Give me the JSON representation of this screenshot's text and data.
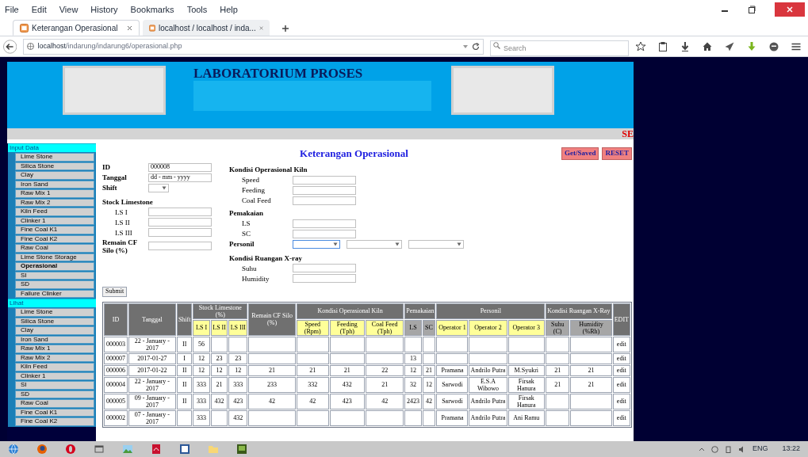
{
  "menu": [
    "File",
    "Edit",
    "View",
    "History",
    "Bookmarks",
    "Tools",
    "Help"
  ],
  "tabs": [
    {
      "title": "Keterangan Operasional",
      "selected": true
    },
    {
      "title": "localhost / localhost / inda...",
      "selected": false
    }
  ],
  "url": {
    "host": "localhost",
    "path": "/indarung/indarung6/operasional.php"
  },
  "search": {
    "placeholder": "Search"
  },
  "page": {
    "header_title": "LABORATORIUM PROSES",
    "marquee": "SE",
    "sidebar": [
      {
        "title": "Input Data",
        "items": [
          {
            "label": "Lime Stone",
            "selected": false
          },
          {
            "label": "Silica Stone",
            "selected": false
          },
          {
            "label": "Clay",
            "selected": false
          },
          {
            "label": "Iron Sand",
            "selected": false
          },
          {
            "label": "Raw Mix 1",
            "selected": false
          },
          {
            "label": "Raw Mix 2",
            "selected": false
          },
          {
            "label": "Kiln Feed",
            "selected": false
          },
          {
            "label": "Clinker 1",
            "selected": false
          },
          {
            "label": "Fine Coal K1",
            "selected": false
          },
          {
            "label": "Fine Coal K2",
            "selected": false
          },
          {
            "label": "Raw Coal",
            "selected": false
          },
          {
            "label": "Lime Stone Storage",
            "selected": false
          },
          {
            "label": "Operasional",
            "selected": true
          },
          {
            "label": "SI",
            "selected": false
          },
          {
            "label": "SD",
            "selected": false
          },
          {
            "label": "Failure Clinker",
            "selected": false
          }
        ]
      },
      {
        "title": "Lihat",
        "items": [
          {
            "label": "Lime Stone",
            "selected": false
          },
          {
            "label": "Silica Stone",
            "selected": false
          },
          {
            "label": "Clay",
            "selected": false
          },
          {
            "label": "Iron Sand",
            "selected": false
          },
          {
            "label": "Raw Mix 1",
            "selected": false
          },
          {
            "label": "Raw Mix 2",
            "selected": false
          },
          {
            "label": "Kiln Feed",
            "selected": false
          },
          {
            "label": "Clinker 1",
            "selected": false
          },
          {
            "label": "SI",
            "selected": false
          },
          {
            "label": "SD",
            "selected": false
          },
          {
            "label": "Raw Coal",
            "selected": false
          },
          {
            "label": "Fine Coal K1",
            "selected": false
          },
          {
            "label": "Fine Coal K2",
            "selected": false
          }
        ]
      }
    ],
    "title": "Keterangan Operasional",
    "top_buttons": [
      "Get/Saved",
      "RESET"
    ],
    "form_left": [
      {
        "kind": "field",
        "label": "ID",
        "value": "000008"
      },
      {
        "kind": "field",
        "label": "Tanggal",
        "value": "dd - mm - yyyy"
      },
      {
        "kind": "select",
        "label": "Shift"
      },
      {
        "kind": "heading",
        "label": "Stock Limestone"
      },
      {
        "kind": "subfield",
        "label": "LS I"
      },
      {
        "kind": "subfield",
        "label": "LS II"
      },
      {
        "kind": "subfield",
        "label": "LS III"
      },
      {
        "kind": "field",
        "label": "Remain CF Silo (%)"
      }
    ],
    "form_right": [
      {
        "kind": "heading",
        "label": "Kondisi Operasional Kiln"
      },
      {
        "kind": "subfield",
        "label": "Speed"
      },
      {
        "kind": "subfield",
        "label": "Feeding"
      },
      {
        "kind": "subfield",
        "label": "Coal Feed"
      },
      {
        "kind": "heading",
        "label": "Pemakaian"
      },
      {
        "kind": "subfield",
        "label": "LS"
      },
      {
        "kind": "subfield",
        "label": "SC"
      },
      {
        "kind": "selects",
        "label": "Personil",
        "selects": [
          {
            "focused": true
          },
          {
            "focused": false
          },
          {
            "focused": false
          }
        ]
      },
      {
        "kind": "heading",
        "label": "Kondisi Ruangan X-ray"
      },
      {
        "kind": "subfield",
        "label": "Suhu"
      },
      {
        "kind": "subfield",
        "label": "Humidity"
      }
    ],
    "submit": "Submit",
    "table": {
      "header_groups": [
        {
          "label": "ID"
        },
        {
          "label": "Tanggal"
        },
        {
          "label": "Shift"
        },
        {
          "label": "Stock Limestone (%)",
          "subcolumns": [
            {
              "label": "LS I",
              "color": "#ffff99"
            },
            {
              "label": "LS II",
              "color": "#ffff99"
            },
            {
              "label": "LS III",
              "color": "#ffff99"
            }
          ]
        },
        {
          "label": "Remain CF Silo (%)"
        },
        {
          "label": "Kondisi Operasional Kiln",
          "subcolumns": [
            {
              "label": "Speed (Rpm)",
              "color": "#ffff99"
            },
            {
              "label": "Feeding (Tph)",
              "color": "#ffff99"
            },
            {
              "label": "Coal Feed (Tph)",
              "color": "#ffff99"
            }
          ]
        },
        {
          "label": "Pemakaian",
          "subcolumns": [
            {
              "label": "LS",
              "color": "#a6a6a6"
            },
            {
              "label": "SC",
              "color": "#a6a6a6"
            }
          ]
        },
        {
          "label": "Personil",
          "subcolumns": [
            {
              "label": "Operator 1",
              "color": "#ffff99"
            },
            {
              "label": "Operator 2",
              "color": "#ffff99"
            },
            {
              "label": "Operator 3",
              "color": "#ffff99"
            }
          ]
        },
        {
          "label": "Kondisi Ruangan X-Ray",
          "subcolumns": [
            {
              "label": "Suhu (C)",
              "color": "#a6a6a6"
            },
            {
              "label": "Humidity (%Rh)",
              "color": "#a6a6a6"
            }
          ]
        },
        {
          "label": "EDIT"
        }
      ],
      "rows": [
        [
          "000003",
          "22 - January - 2017",
          "II",
          "56",
          null,
          null,
          null,
          null,
          null,
          null,
          null,
          null,
          null,
          null,
          null,
          null,
          null,
          "edit"
        ],
        [
          "000007",
          "2017-01-27",
          "I",
          "12",
          "23",
          "23",
          null,
          null,
          null,
          null,
          "13",
          null,
          null,
          null,
          null,
          null,
          null,
          "edit"
        ],
        [
          "000006",
          "2017-01-22",
          "II",
          "12",
          "12",
          "12",
          "21",
          "21",
          "21",
          "22",
          "12",
          "21",
          "Pramana",
          "Andrilo Putra",
          "M.Syukri",
          "21",
          "21",
          "edit"
        ],
        [
          "000004",
          "22 - January - 2017",
          "II",
          "333",
          "21",
          "333",
          "233",
          "332",
          "432",
          "21",
          "32",
          "12",
          "Sarwodi",
          "E.S.A Wibowo",
          "Firsak Hanura",
          "21",
          "21",
          "edit"
        ],
        [
          "000005",
          "09 - January - 2017",
          "II",
          "333",
          "432",
          "423",
          "42",
          "42",
          "423",
          "42",
          "2423",
          "42",
          "Sarwodi",
          "Andrilo Putra",
          "Firsak Hanura",
          null,
          null,
          "edit"
        ],
        [
          "000002",
          "07 - January - 2017",
          null,
          "333",
          null,
          "432",
          null,
          null,
          null,
          null,
          null,
          null,
          "Pramana",
          "Andrilo Putra",
          "Ani Ramu",
          null,
          null,
          "edit"
        ]
      ]
    }
  },
  "tray": {
    "language": "ENG",
    "time": "13:22"
  }
}
